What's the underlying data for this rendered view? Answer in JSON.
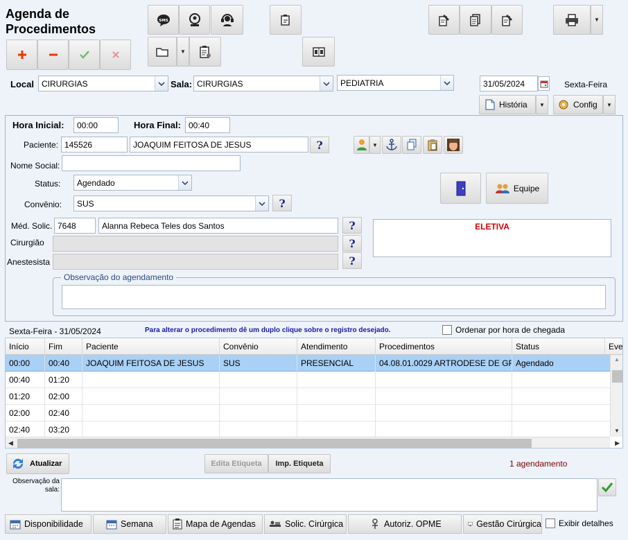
{
  "window": {
    "title_line1": "Agenda de",
    "title_line2": "Procedimentos"
  },
  "filters": {
    "local_label": "Local",
    "local_value": "CIRURGIAS",
    "sala_label": "Sala:",
    "sala_value": "CIRURGIAS",
    "specialty_value": "PEDIATRIA",
    "date_value": "31/05/2024",
    "weekday": "Sexta-Feira",
    "historia_label": "História",
    "config_label": "Config"
  },
  "form": {
    "hora_inicial_label": "Hora Inicial:",
    "hora_inicial_value": "00:00",
    "hora_final_label": "Hora Final:",
    "hora_final_value": "00:40",
    "paciente_label": "Paciente:",
    "paciente_id": "145526",
    "paciente_nome": "JOAQUIM  FEITOSA DE JESUS",
    "nome_social_label": "Nome Social:",
    "nome_social_value": "",
    "status_label": "Status:",
    "status_value": "Agendado",
    "convenio_label": "Convênio:",
    "convenio_value": "SUS",
    "med_solic_label": "Méd. Solic.",
    "med_solic_id": "7648",
    "med_solic_nome": "Alanna Rebeca Teles dos Santos",
    "cirurgiao_label": "Cirurgião",
    "anestesista_label": "Anestesista",
    "eletiva_text": "ELETIVA",
    "equipe_label": "Equipe",
    "observacao_legend": "Observação do agendamento",
    "help_mark": "?"
  },
  "schedule": {
    "date_caption": "Sexta-Feira - 31/05/2024",
    "hint": "Para alterar o procedimento dê um duplo clique sobre o registro desejado.",
    "order_checkbox_label": "Ordenar por hora de chegada",
    "columns": [
      "Início",
      "Fim",
      "Paciente",
      "Convênio",
      "Atendimento",
      "Procedimentos",
      "Status",
      "Eve"
    ],
    "rows": [
      [
        "00:00",
        "00:40",
        "JOAQUIM FEITOSA DE JESUS",
        "SUS",
        "PRESENCIAL",
        "04.08.01.0029 ARTRODESE DE GR",
        "Agendado"
      ],
      [
        "00:40",
        "01:20",
        "",
        "",
        "",
        "",
        ""
      ],
      [
        "01:20",
        "02:00",
        "",
        "",
        "",
        "",
        ""
      ],
      [
        "02:00",
        "02:40",
        "",
        "",
        "",
        "",
        ""
      ],
      [
        "02:40",
        "03:20",
        "",
        "",
        "",
        "",
        ""
      ]
    ]
  },
  "actions": {
    "atualizar_label": "Atualizar",
    "edita_etiqueta_label": "Edita Etiqueta",
    "imp_etiqueta_label": "Imp. Etiqueta",
    "count_text": "1 agendamento",
    "obs_sala_label_line1": "Observação da",
    "obs_sala_label_line2": "sala:",
    "obs_sala_value": ""
  },
  "bottom_bar": {
    "disponibilidade": "Disponibilidade",
    "semana": "Semana",
    "mapa": "Mapa de Agendas",
    "solic": "Solic. Cirúrgica",
    "autoriz": "Autoriz. OPME",
    "gestao": "Gestão Cirúrgica",
    "exibir": "Exibir detalhes"
  },
  "colors": {
    "accent_red": "#d00000",
    "selection": "#a9d0f5",
    "count_text": "#7a0000",
    "hint_text": "#1a1aa0"
  }
}
